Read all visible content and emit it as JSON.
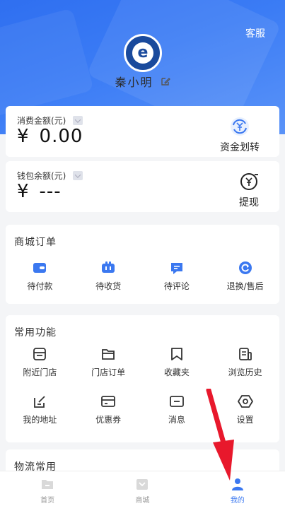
{
  "header": {
    "service_label": "客服",
    "avatar_letter": "e",
    "username": "秦小明"
  },
  "money_card": {
    "label": "消费金额(元)",
    "currency": "¥",
    "amount": "0.00",
    "action_label": "资金划转"
  },
  "wallet_card": {
    "label": "钱包余额(元)",
    "currency": "¥",
    "amount": "---",
    "action_label": "提现"
  },
  "orders": {
    "title": "商城订单",
    "items": [
      {
        "label": "待付款",
        "icon": "wallet-icon"
      },
      {
        "label": "待收货",
        "icon": "truck-icon"
      },
      {
        "label": "待评论",
        "icon": "comment-icon"
      },
      {
        "label": "退换/售后",
        "icon": "refresh-icon"
      }
    ]
  },
  "common": {
    "title": "常用功能",
    "items": [
      {
        "label": "附近门店",
        "icon": "store-icon"
      },
      {
        "label": "门店订单",
        "icon": "folder-icon"
      },
      {
        "label": "收藏夹",
        "icon": "bookmark-icon"
      },
      {
        "label": "浏览历史",
        "icon": "history-icon"
      },
      {
        "label": "我的地址",
        "icon": "edit-address-icon"
      },
      {
        "label": "优惠券",
        "icon": "coupon-icon"
      },
      {
        "label": "消息",
        "icon": "message-icon"
      },
      {
        "label": "设置",
        "icon": "settings-icon"
      }
    ]
  },
  "logistics": {
    "title": "物流常用"
  },
  "tabbar": {
    "items": [
      {
        "label": "首页",
        "icon": "home-icon",
        "active": false
      },
      {
        "label": "商城",
        "icon": "mall-icon",
        "active": false
      },
      {
        "label": "我的",
        "icon": "user-icon",
        "active": true
      }
    ]
  },
  "colors": {
    "brand_blue": "#3b78f0",
    "annotation_arrow": "#e8182c"
  }
}
